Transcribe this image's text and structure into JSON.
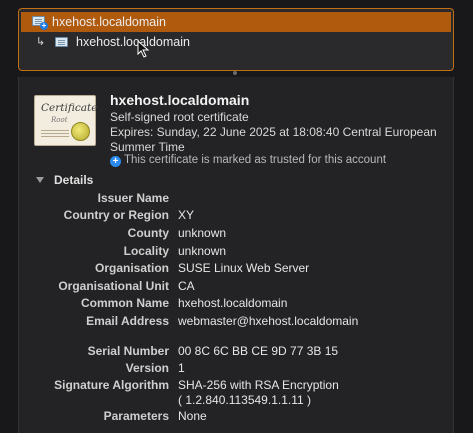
{
  "chain": {
    "root": "hxehost.localdomain",
    "child": "hxehost.localdomain"
  },
  "cert": {
    "icon_text": "Certificate",
    "icon_subtext": "Root",
    "name": "hxehost.localdomain",
    "subtitle": "Self-signed root certificate",
    "expires": "Expires: Sunday, 22 June 2025 at 18:08:40 Central European Summer Time",
    "trusted": "This certificate is marked as trusted for this account"
  },
  "details": {
    "header": "Details",
    "rows": [
      {
        "k": "Issuer Name",
        "v": ""
      },
      {
        "k": "Country or Region",
        "v": "XY"
      },
      {
        "k": "County",
        "v": "unknown"
      },
      {
        "k": "Locality",
        "v": "unknown"
      },
      {
        "k": "Organisation",
        "v": "SUSE Linux Web Server"
      },
      {
        "k": "Organisational Unit",
        "v": "CA"
      },
      {
        "k": "Common Name",
        "v": "hxehost.localdomain"
      },
      {
        "k": "Email Address",
        "v": "webmaster@hxehost.localdomain"
      },
      {
        "k": "Serial Number",
        "v": "00 8C 6C BB CE 9D 77 3B 15"
      },
      {
        "k": "Version",
        "v": "1"
      },
      {
        "k": "Signature Algorithm",
        "v": "SHA-256 with RSA Encryption",
        "v2": "( 1.2.840.113549.1.1.11 )"
      },
      {
        "k": "Parameters",
        "v": "None"
      }
    ]
  }
}
